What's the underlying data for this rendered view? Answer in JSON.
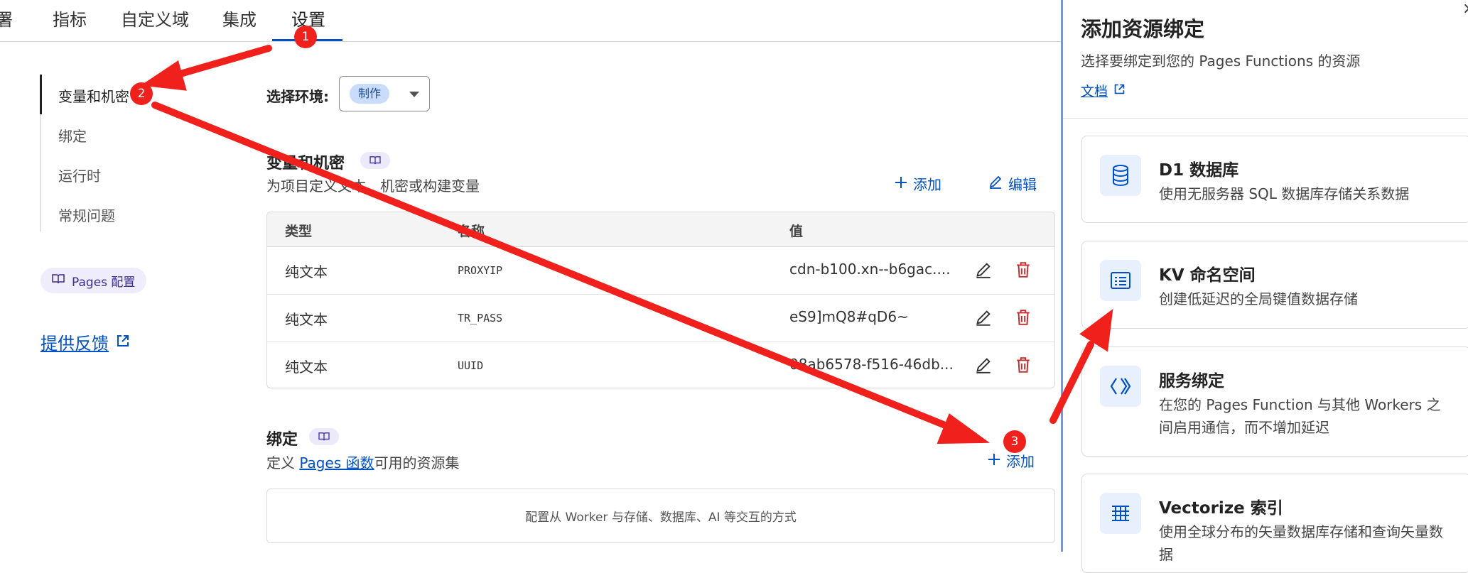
{
  "tabs": [
    {
      "label": "署"
    },
    {
      "label": "指标"
    },
    {
      "label": "自定义域"
    },
    {
      "label": "集成"
    },
    {
      "label": "设置"
    }
  ],
  "sidebar": {
    "items": [
      {
        "label": "变量和机密"
      },
      {
        "label": "绑定"
      },
      {
        "label": "运行时"
      },
      {
        "label": "常规问题"
      }
    ],
    "pages_config": "Pages 配置",
    "feedback": "提供反馈"
  },
  "env": {
    "label": "选择环境:",
    "selected": "制作"
  },
  "variables": {
    "title": "变量和机密",
    "desc": "为项目定义文本、机密或构建变量",
    "add": "添加",
    "edit": "编辑",
    "columns": [
      "类型",
      "名称",
      "值"
    ],
    "rows": [
      {
        "type": "纯文本",
        "name": "PROXYIP",
        "value": "cdn-b100.xn--b6gac...."
      },
      {
        "type": "纯文本",
        "name": "TR_PASS",
        "value": "eS9]mQ8#qD6~"
      },
      {
        "type": "纯文本",
        "name": "UUID",
        "value": "08ab6578-f516-46db..."
      }
    ]
  },
  "bindings": {
    "title": "绑定",
    "desc_prefix": "定义 ",
    "desc_link": "Pages 函数",
    "desc_suffix": "可用的资源集",
    "add": "添加",
    "empty": "配置从 Worker 与存储、数据库、AI 等交互的方式"
  },
  "panel": {
    "title": "添加资源绑定",
    "subtitle": "选择要绑定到您的 Pages Functions 的资源",
    "doc": "文档",
    "close": "×",
    "cards": [
      {
        "title": "D1 数据库",
        "desc": "使用无服务器 SQL 数据库存储关系数据",
        "icon": "database-icon"
      },
      {
        "title": "KV 命名空间",
        "desc": "创建低延迟的全局键值数据存储",
        "icon": "kv-list-icon"
      },
      {
        "title": "服务绑定",
        "desc": "在您的 Pages Function 与其他 Workers 之间启用通信，而不增加延迟",
        "icon": "service-binding-icon"
      },
      {
        "title": "Vectorize 索引",
        "desc": "使用全球分布的矢量数据库存储和查询矢量数据",
        "icon": "vectorize-icon"
      }
    ]
  },
  "annotations": [
    "1",
    "2",
    "3"
  ],
  "colors": {
    "accent": "#0051c3",
    "danger": "#c42d2d",
    "annotation": "#f0201c"
  }
}
